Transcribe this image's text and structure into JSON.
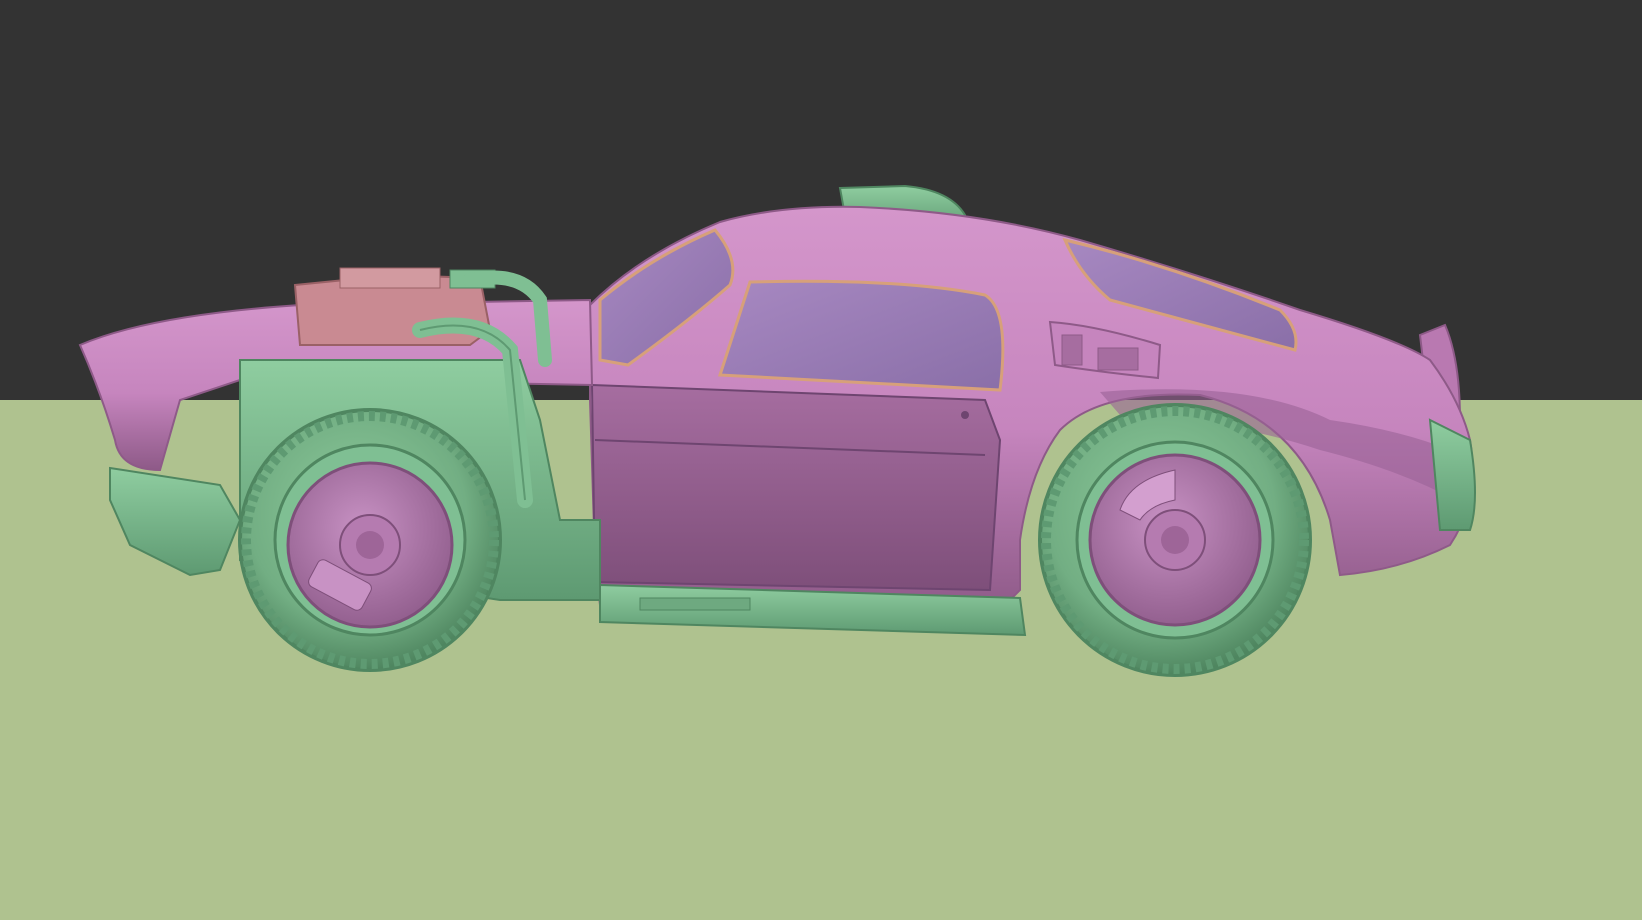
{
  "scene": {
    "background_color": "#333333",
    "ground_color": "#AFC28F",
    "body_color": "#C685BE",
    "body_shadow_color": "#9E6598",
    "glass_color": "#9A7DB5",
    "part_color": "#7FBF93",
    "part_shadow_color": "#5E9A72",
    "trim_color": "#D7A07A",
    "engine_block_color": "#C98A92",
    "icons": [
      "car-model",
      "front-wheel",
      "rear-wheel",
      "roof-scoop",
      "engine",
      "exhaust-pipe",
      "door",
      "rear-spoiler",
      "side-skirt"
    ]
  }
}
